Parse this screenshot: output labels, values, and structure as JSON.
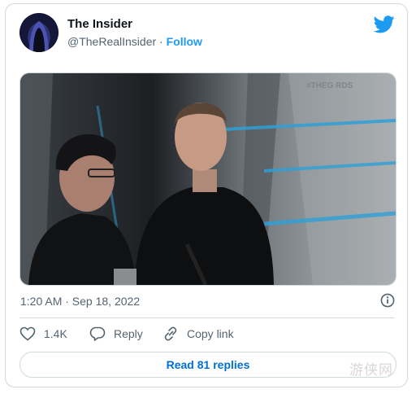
{
  "tweet": {
    "display_name": "The Insider",
    "handle": "@TheRealInsider",
    "separator": "·",
    "follow_label": "Follow",
    "timestamp": "1:20 AM · Sep 18, 2022",
    "media_overlay_text": "#THEG    RDS"
  },
  "actions": {
    "like_count": "1.4K",
    "reply_label": "Reply",
    "copy_link_label": "Copy link"
  },
  "replies_button": {
    "label": "Read 81 replies"
  },
  "watermark": "游侠网",
  "colors": {
    "accent": "#1d9bf0",
    "link": "#006fd6",
    "muted": "#536471",
    "border": "#cfd9de"
  },
  "icons": {
    "brand": "twitter-bird-icon",
    "info": "info-icon",
    "like": "heart-icon",
    "reply": "speech-bubble-icon",
    "copy": "link-icon"
  }
}
